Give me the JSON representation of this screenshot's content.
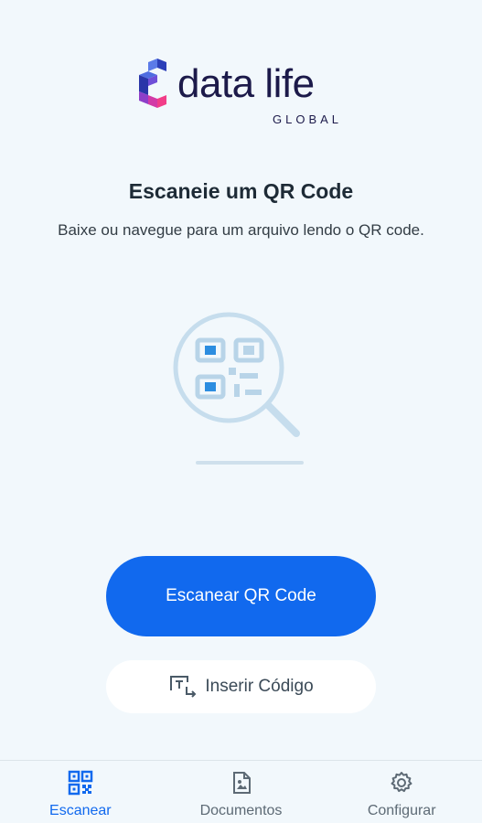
{
  "logo": {
    "wordmark": "data life",
    "sub": "GLOBAL"
  },
  "main": {
    "title": "Escaneie um QR Code",
    "subtitle": "Baixe ou navegue para um arquivo lendo o QR code."
  },
  "actions": {
    "scan_label": "Escanear QR Code",
    "insert_code_label": "Inserir Código"
  },
  "bottom_nav": {
    "items": [
      {
        "label": "Escanear",
        "icon": "qr-code-icon",
        "active": true
      },
      {
        "label": "Documentos",
        "icon": "document-icon",
        "active": false
      },
      {
        "label": "Configurar",
        "icon": "gear-icon",
        "active": false
      }
    ]
  },
  "colors": {
    "accent": "#1169ee",
    "background": "#f2f8fc",
    "illustration": "#c6dded"
  }
}
